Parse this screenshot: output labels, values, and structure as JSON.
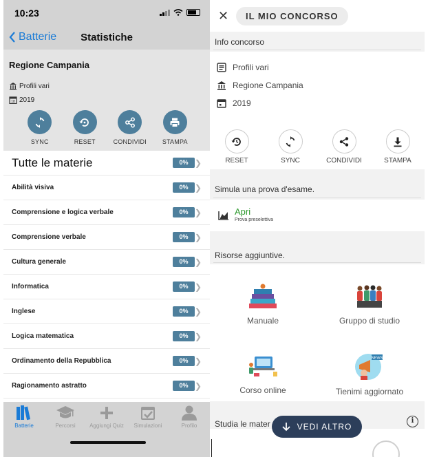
{
  "left": {
    "status_time": "10:23",
    "nav": {
      "back_label": "Batterie",
      "title": "Statistiche"
    },
    "header": {
      "region": "Regione Campania",
      "profile": "Profili vari",
      "year": "2019"
    },
    "actions": [
      "SYNC",
      "RESET",
      "CONDIVIDI",
      "STAMPA"
    ],
    "all_subjects": {
      "label": "Tutte le materie",
      "percent": "0%"
    },
    "subjects": [
      {
        "label": "Abilità visiva",
        "percent": "0%"
      },
      {
        "label": "Comprensione e logica verbale",
        "percent": "0%"
      },
      {
        "label": "Comprensione verbale",
        "percent": "0%"
      },
      {
        "label": "Cultura generale",
        "percent": "0%"
      },
      {
        "label": "Informatica",
        "percent": "0%"
      },
      {
        "label": "Inglese",
        "percent": "0%"
      },
      {
        "label": "Logica matematica",
        "percent": "0%"
      },
      {
        "label": "Ordinamento della Repubblica",
        "percent": "0%"
      },
      {
        "label": "Ragionamento astratto",
        "percent": "0%"
      }
    ],
    "tabs": [
      {
        "label": "Batterie",
        "icon": "books-icon",
        "active": true
      },
      {
        "label": "Percorsi",
        "icon": "graduation-cap-icon",
        "active": false
      },
      {
        "label": "Aggiungi Quiz",
        "icon": "plus-icon",
        "active": false
      },
      {
        "label": "Simulazioni",
        "icon": "calendar-check-icon",
        "active": false
      },
      {
        "label": "Profilo",
        "icon": "person-icon",
        "active": false
      }
    ],
    "colors": {
      "accent": "#4e7f9c",
      "link": "#1a7bd6",
      "bar_bg": "#d3d3d3"
    }
  },
  "right": {
    "header_title": "IL MIO CONCORSO",
    "info_section": "Info concorso",
    "info": {
      "profile": "Profili vari",
      "region": "Regione Campania",
      "year": "2019"
    },
    "actions": [
      "RESET",
      "SYNC",
      "CONDIVIDI",
      "STAMPA"
    ],
    "simula_section": "Simula una prova d'esame.",
    "apri": {
      "title": "Apri",
      "subtitle": "Prova preselettiva"
    },
    "risorse_section": "Risorse aggiuntive.",
    "resources": [
      "Manuale",
      "Gruppo di studio",
      "Corso online",
      "Tienimi aggiornato"
    ],
    "studia_section": "Studia le mater",
    "vedi_altro": "VEDI ALTRO",
    "colors": {
      "vedi_bg": "#2c3e5a",
      "apri": "#2e9a2e"
    }
  }
}
